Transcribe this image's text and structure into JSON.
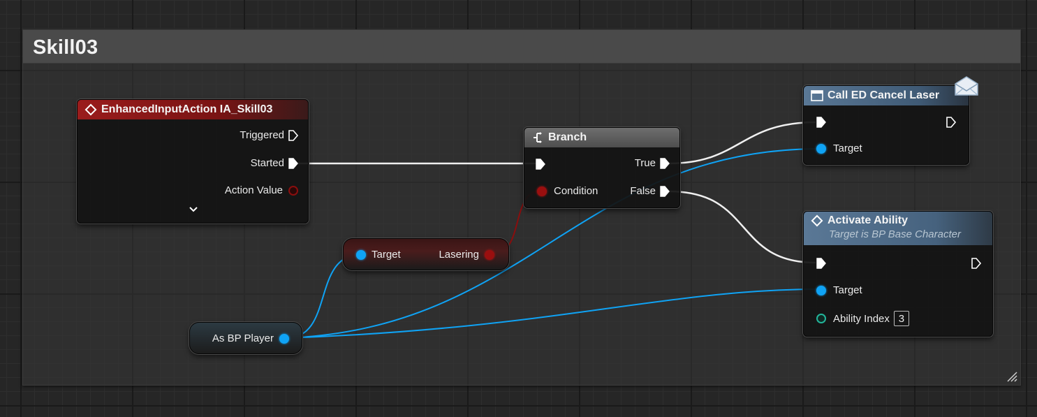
{
  "comment": {
    "title": "Skill03"
  },
  "input_event": {
    "title": "EnhancedInputAction IA_Skill03",
    "pins": {
      "triggered": "Triggered",
      "started": "Started",
      "action_value": "Action Value"
    },
    "expand_glyph": "⌄"
  },
  "branch": {
    "title": "Branch",
    "pins": {
      "condition": "Condition",
      "true": "True",
      "false": "False"
    }
  },
  "lasering_getter": {
    "target": "Target",
    "output": "Lasering"
  },
  "cast_node": {
    "output": "As BP Player"
  },
  "call_cancel_laser": {
    "title": "Call ED Cancel Laser",
    "pins": {
      "target": "Target"
    },
    "icon": "envelope-icon"
  },
  "activate_ability": {
    "title": "Activate Ability",
    "subtitle": "Target is BP Base Character",
    "pins": {
      "target": "Target",
      "ability_index": "Ability Index"
    },
    "ability_index_value": "3"
  },
  "colors": {
    "exec": "#ffffff",
    "object": "#0fa3f5",
    "boolean": "#9a0f0f",
    "integer": "#22b59a",
    "event_header": "#8f1818",
    "function_header": "#4a6a88"
  }
}
